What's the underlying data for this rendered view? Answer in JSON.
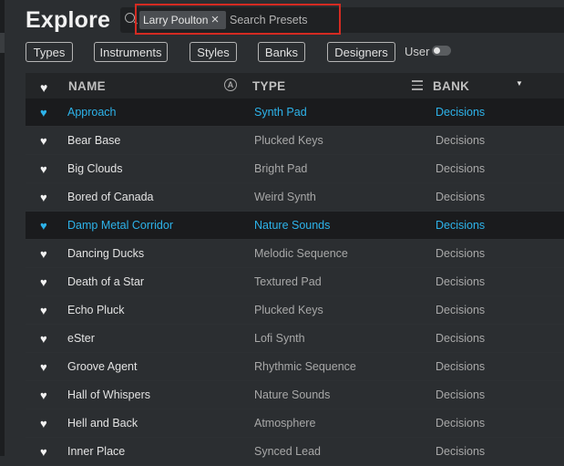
{
  "page": {
    "title": "Explore"
  },
  "search": {
    "chip_label": "Larry Poulton",
    "chip_close_glyph": "×",
    "placeholder": "Search Presets",
    "value": ""
  },
  "filters": [
    {
      "label": "Types"
    },
    {
      "label": "Instruments"
    },
    {
      "label": "Styles"
    },
    {
      "label": "Banks"
    },
    {
      "label": "Designers"
    }
  ],
  "user_toggle": {
    "label": "User",
    "on": false
  },
  "table": {
    "columns": {
      "name": "NAME",
      "type": "TYPE",
      "bank": "BANK"
    },
    "icons": {
      "favorite": "heart-icon",
      "arturia": "arturia-logo-icon",
      "sort": "hamburger-sort-icon",
      "dropdown": "triangle-down-icon"
    },
    "highlight_color": "#2db3ea",
    "rows": [
      {
        "name": "Approach",
        "type": "Synth Pad",
        "bank": "Decisions",
        "selected": true
      },
      {
        "name": "Bear Base",
        "type": "Plucked Keys",
        "bank": "Decisions",
        "selected": false
      },
      {
        "name": "Big Clouds",
        "type": "Bright Pad",
        "bank": "Decisions",
        "selected": false
      },
      {
        "name": "Bored of Canada",
        "type": "Weird Synth",
        "bank": "Decisions",
        "selected": false
      },
      {
        "name": "Damp Metal Corridor",
        "type": "Nature Sounds",
        "bank": "Decisions",
        "selected": true
      },
      {
        "name": "Dancing Ducks",
        "type": "Melodic Sequence",
        "bank": "Decisions",
        "selected": false
      },
      {
        "name": "Death of a Star",
        "type": "Textured Pad",
        "bank": "Decisions",
        "selected": false
      },
      {
        "name": "Echo Pluck",
        "type": "Plucked Keys",
        "bank": "Decisions",
        "selected": false
      },
      {
        "name": "eSter",
        "type": "Lofi Synth",
        "bank": "Decisions",
        "selected": false
      },
      {
        "name": "Groove Agent",
        "type": "Rhythmic Sequence",
        "bank": "Decisions",
        "selected": false
      },
      {
        "name": "Hall of Whispers",
        "type": "Nature Sounds",
        "bank": "Decisions",
        "selected": false
      },
      {
        "name": "Hell and Back",
        "type": "Atmosphere",
        "bank": "Decisions",
        "selected": false
      },
      {
        "name": "Inner Place",
        "type": "Synced Lead",
        "bank": "Decisions",
        "selected": false
      }
    ]
  }
}
